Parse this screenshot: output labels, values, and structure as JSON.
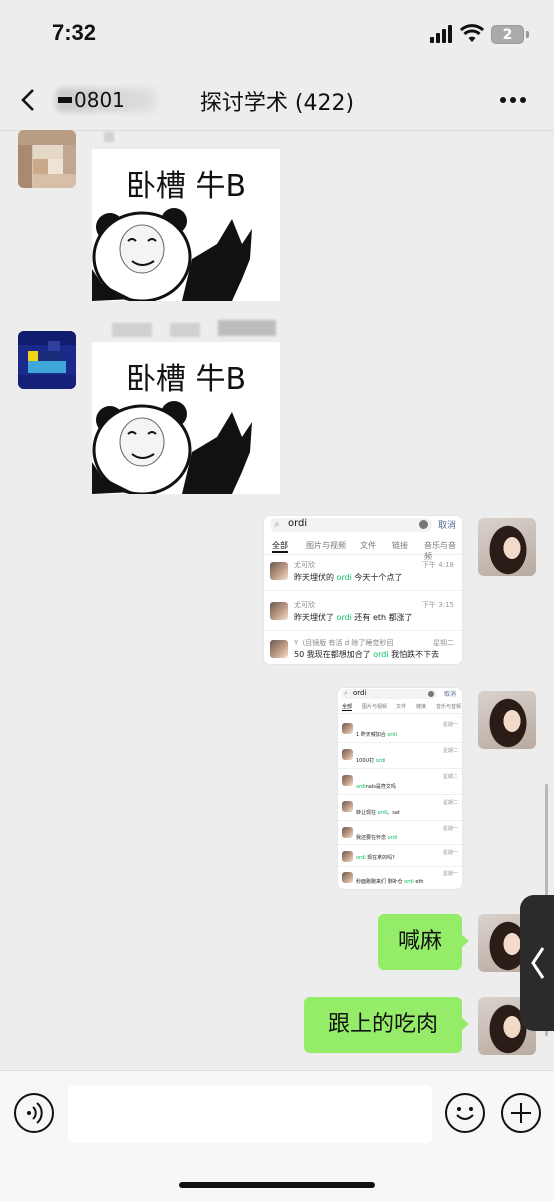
{
  "status": {
    "time": "7:32",
    "battery": "2"
  },
  "nav": {
    "back_label": "0801",
    "title": "探讨学术 (422)"
  },
  "messages": {
    "m1": {
      "sticker_text": "卧槽 牛B"
    },
    "m2": {
      "sticker_text": "卧槽 牛B"
    },
    "m3": {
      "search_query": "ordi",
      "cancel": "取消",
      "tabs": [
        "全部",
        "图片与视频",
        "文件",
        "链接",
        "音乐与音频"
      ],
      "rows": [
        {
          "name": "尤可欣",
          "time": "下午 4:18",
          "pre": "昨天埋伏的 ",
          "hl": "ordi",
          "post": " 今天十个点了"
        },
        {
          "name": "尤可欣",
          "time": "下午 3:15",
          "pre": "昨天埋伏了 ",
          "hl": "ordi",
          "post": " 还有 eth 都涨了"
        },
        {
          "name": "Y（目镜版 有活 d 除了睡觉秒回",
          "time": "星期二",
          "pre": "50 我现在都想加合了 ",
          "hl": "ordi",
          "post": " 我怕跌不下去"
        }
      ]
    },
    "m4": {
      "search_query": "ordi",
      "cancel": "取消",
      "tabs": [
        "全部",
        "图片与视频",
        "文件",
        "链接",
        "音乐与音频"
      ],
      "rows": [
        {
          "time": "星期一",
          "pre": "1 昨天喊加合 ",
          "hl": "ordi",
          "post": ""
        },
        {
          "time": "星期二",
          "pre": "100U打 ",
          "hl": "ordi",
          "post": ""
        },
        {
          "time": "星期二",
          "pre": "",
          "hl": "ordi",
          "post": "nals是符文吗"
        },
        {
          "time": "星期二",
          "pre": "转让现在 ",
          "hl": "ordi",
          "post": "。sat"
        },
        {
          "time": "星期一",
          "pre": "我还要在怀念 ",
          "hl": "ordi",
          "post": ""
        },
        {
          "time": "星期一",
          "pre": "",
          "hl": "ordi",
          "post": " 现在拿的吗?"
        },
        {
          "time": "星期一",
          "pre": "秒面跑跑来们 剩补仓 ",
          "hl": "ordi",
          "post": " eth"
        }
      ]
    },
    "m5": {
      "text": "喊麻"
    },
    "m6": {
      "text": "跟上的吃肉"
    }
  },
  "colors": {
    "bubble": "#95ec69",
    "highlight": "#07c160",
    "background": "#ededed"
  }
}
